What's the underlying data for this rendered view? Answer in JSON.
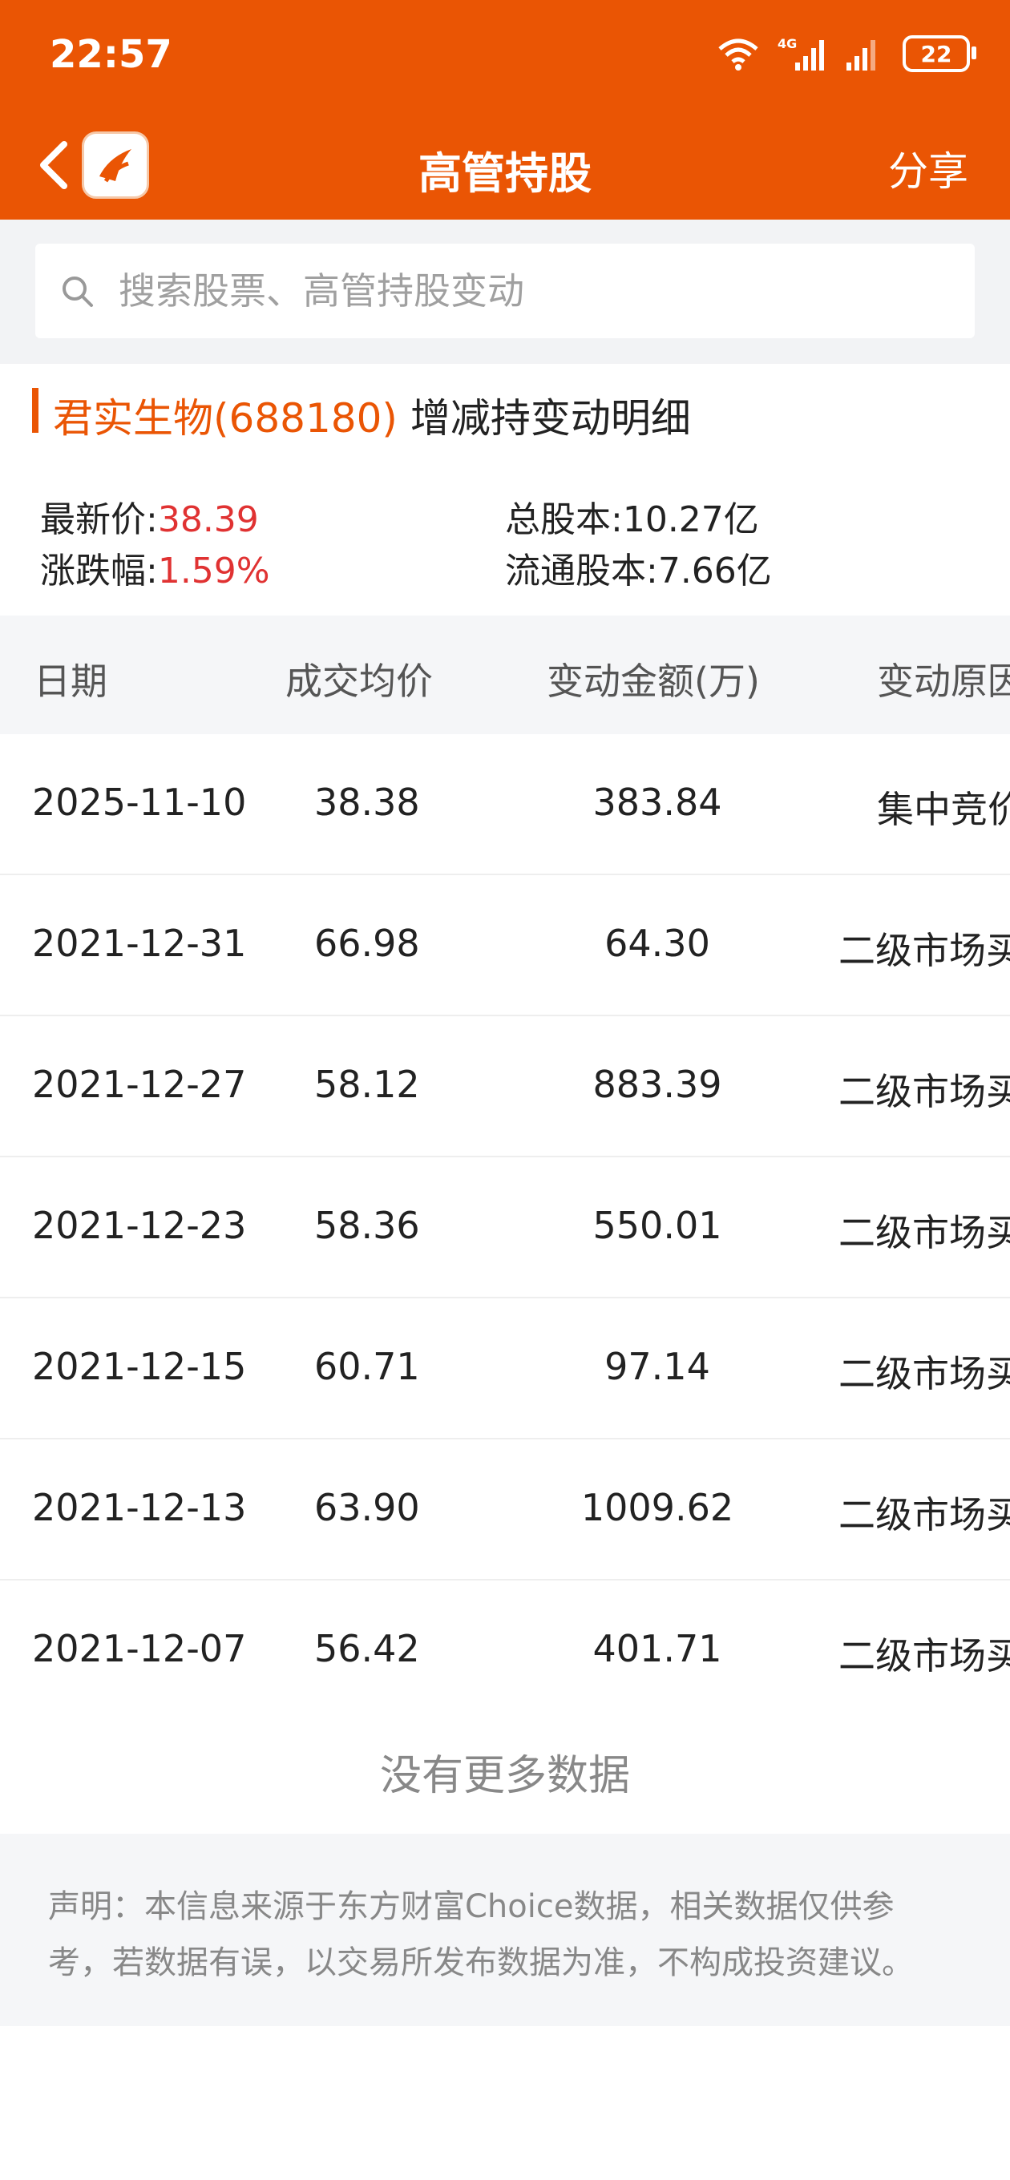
{
  "status_bar": {
    "time": "22:57",
    "battery": "22",
    "network": "4G"
  },
  "nav": {
    "title": "高管持股",
    "share_label": "分享"
  },
  "search": {
    "placeholder": "搜索股票、高管持股变动"
  },
  "section": {
    "stock_name": "君实生物(688180)",
    "title_suffix": "增减持变动明细"
  },
  "stock_info": {
    "latest_price_label": "最新价:",
    "latest_price": "38.39",
    "change_label": "涨跌幅:",
    "change_pct": "1.59%",
    "total_shares_label": "总股本:",
    "total_shares": "10.27亿",
    "float_shares_label": "流通股本:",
    "float_shares": "7.66亿"
  },
  "table": {
    "headers": [
      "日期",
      "成交均价",
      "变动金额(万)",
      "变动原因"
    ],
    "rows": [
      {
        "date": "2025-11-10",
        "price": "38.38",
        "amount": "383.84",
        "reason": "集中竞价"
      },
      {
        "date": "2021-12-31",
        "price": "66.98",
        "amount": "64.30",
        "reason": "二级市场买卖"
      },
      {
        "date": "2021-12-27",
        "price": "58.12",
        "amount": "883.39",
        "reason": "二级市场买卖"
      },
      {
        "date": "2021-12-23",
        "price": "58.36",
        "amount": "550.01",
        "reason": "二级市场买卖"
      },
      {
        "date": "2021-12-15",
        "price": "60.71",
        "amount": "97.14",
        "reason": "二级市场买卖"
      },
      {
        "date": "2021-12-13",
        "price": "63.90",
        "amount": "1009.62",
        "reason": "二级市场买卖"
      },
      {
        "date": "2021-12-07",
        "price": "56.42",
        "amount": "401.71",
        "reason": "二级市场买卖"
      }
    ]
  },
  "footer": {
    "no_more": "没有更多数据",
    "disclaimer": "声明：本信息来源于东方财富Choice数据，相关数据仅供参考，若数据有误，以交易所发布数据为准，不构成投资建议。"
  },
  "colors": {
    "brand": "#ea5504",
    "up": "#e03232"
  }
}
